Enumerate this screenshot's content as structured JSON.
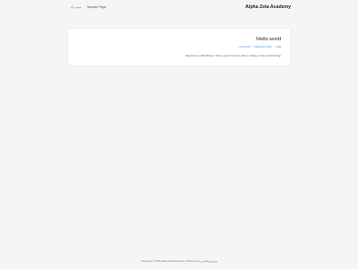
{
  "header": {
    "nav_items": [
      {
        "label": "نمونه برگه",
        "small": true
      },
      {
        "label": "Sample Page",
        "small": false
      }
    ],
    "site_title": "Alpha Zeta Academy"
  },
  "post": {
    "title": "!Hello world",
    "meta_author": "Jalal",
    "meta_sep1": "/",
    "meta_date": "December 2021",
    "meta_sep2": "/",
    "meta_comments": "1 Comment",
    "excerpt": "Welcome to WordPress. This is your first post. Edit or delete it, then start writing!"
  },
  "footer": {
    "link_text": "وردپرس فارسی",
    "text": "Copyright © 2025 Alpha Zeta Academy | Powered by"
  },
  "colors": {
    "background": "#f5f5f5",
    "card": "#ffffff",
    "link": "#3a7bd5",
    "title": "#222222"
  }
}
